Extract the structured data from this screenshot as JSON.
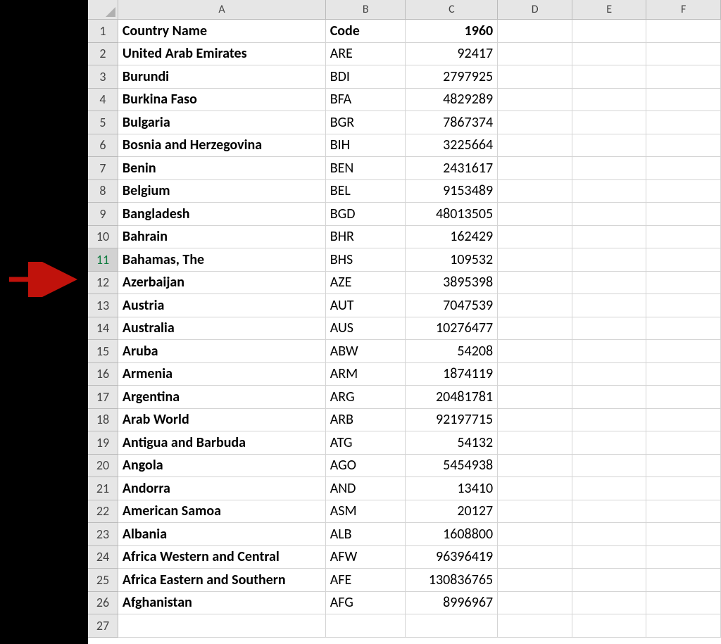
{
  "columns": [
    "A",
    "B",
    "C",
    "D",
    "E",
    "F"
  ],
  "header": {
    "country_label": "Country Name",
    "code_label": "Code",
    "year_label": "1960"
  },
  "selected_row_header": 11,
  "rows": [
    {
      "n": 1,
      "country": "Country Name",
      "code": "Code",
      "value": "1960",
      "is_header": true
    },
    {
      "n": 2,
      "country": "United Arab Emirates",
      "code": "ARE",
      "value": "92417"
    },
    {
      "n": 3,
      "country": "Burundi",
      "code": "BDI",
      "value": "2797925"
    },
    {
      "n": 4,
      "country": "Burkina Faso",
      "code": "BFA",
      "value": "4829289"
    },
    {
      "n": 5,
      "country": "Bulgaria",
      "code": "BGR",
      "value": "7867374"
    },
    {
      "n": 6,
      "country": "Bosnia and Herzegovina",
      "code": "BIH",
      "value": "3225664"
    },
    {
      "n": 7,
      "country": "Benin",
      "code": "BEN",
      "value": "2431617"
    },
    {
      "n": 8,
      "country": "Belgium",
      "code": "BEL",
      "value": "9153489"
    },
    {
      "n": 9,
      "country": "Bangladesh",
      "code": "BGD",
      "value": "48013505"
    },
    {
      "n": 10,
      "country": "Bahrain",
      "code": "BHR",
      "value": "162429"
    },
    {
      "n": 11,
      "country": "Bahamas, The",
      "code": "BHS",
      "value": "109532"
    },
    {
      "n": 12,
      "country": "Azerbaijan",
      "code": "AZE",
      "value": "3895398"
    },
    {
      "n": 13,
      "country": "Austria",
      "code": "AUT",
      "value": "7047539"
    },
    {
      "n": 14,
      "country": "Australia",
      "code": "AUS",
      "value": "10276477"
    },
    {
      "n": 15,
      "country": "Aruba",
      "code": "ABW",
      "value": "54208"
    },
    {
      "n": 16,
      "country": "Armenia",
      "code": "ARM",
      "value": "1874119"
    },
    {
      "n": 17,
      "country": "Argentina",
      "code": "ARG",
      "value": "20481781"
    },
    {
      "n": 18,
      "country": "Arab World",
      "code": "ARB",
      "value": "92197715"
    },
    {
      "n": 19,
      "country": "Antigua and Barbuda",
      "code": "ATG",
      "value": "54132"
    },
    {
      "n": 20,
      "country": "Angola",
      "code": "AGO",
      "value": "5454938"
    },
    {
      "n": 21,
      "country": "Andorra",
      "code": "AND",
      "value": "13410"
    },
    {
      "n": 22,
      "country": "American Samoa",
      "code": "ASM",
      "value": "20127"
    },
    {
      "n": 23,
      "country": "Albania",
      "code": "ALB",
      "value": "1608800"
    },
    {
      "n": 24,
      "country": "Africa Western and Central",
      "code": "AFW",
      "value": "96396419"
    },
    {
      "n": 25,
      "country": "Africa Eastern and Southern",
      "code": "AFE",
      "value": "130836765"
    },
    {
      "n": 26,
      "country": "Afghanistan",
      "code": "AFG",
      "value": "8996967"
    },
    {
      "n": 27,
      "country": "",
      "code": "",
      "value": ""
    }
  ],
  "annotation": {
    "type": "arrow",
    "points_to_row": 11,
    "color": "#c0120b"
  }
}
